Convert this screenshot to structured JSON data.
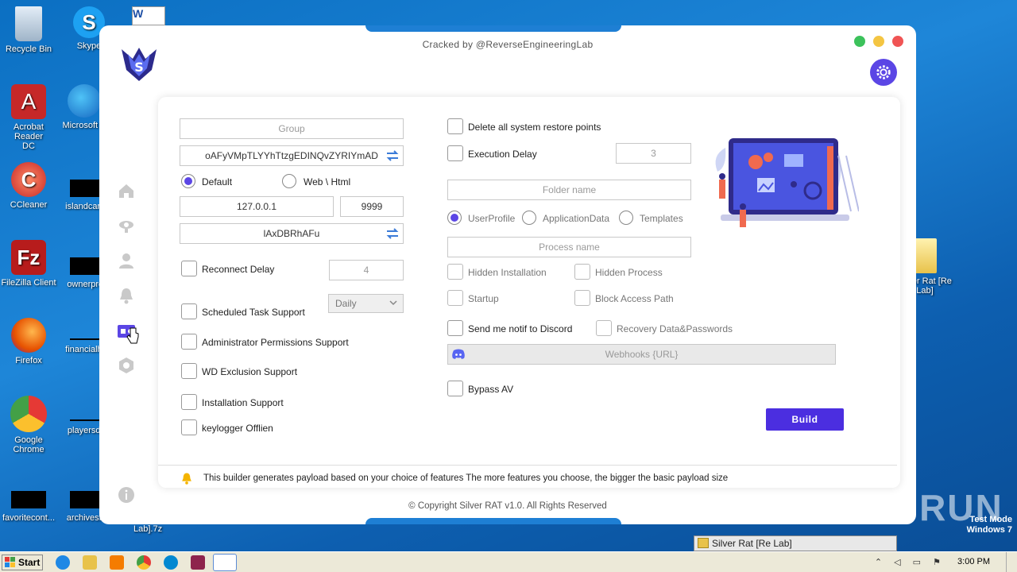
{
  "desktop": {
    "icons": [
      {
        "label": "Recycle Bin",
        "color": "#b7c7d8"
      },
      {
        "label": "Skype",
        "color": "#1da1f2"
      },
      {
        "label": "Acrobat Reader DC",
        "color": "#d32f2f"
      },
      {
        "label": "Microsoft E",
        "color": "#1e88e5"
      },
      {
        "label": "CCleaner",
        "color": "#e53935"
      },
      {
        "label": "islandcard.j",
        "color": "#000000"
      },
      {
        "label": "FileZilla Client",
        "color": "#c62828"
      },
      {
        "label": "ownerpres",
        "color": "#000000"
      },
      {
        "label": "Firefox",
        "color": "#ff7043"
      },
      {
        "label": "financialhot",
        "color": "#000000"
      },
      {
        "label": "Google Chrome",
        "color": "#43a047"
      },
      {
        "label": "playersdie",
        "color": "#000000"
      },
      {
        "label": "favoritecont...",
        "color": "#000000"
      },
      {
        "label": "archivesflo",
        "color": "#000000"
      },
      {
        "label": "Silver Rat [Re Lab]",
        "color": "#f5d76e"
      },
      {
        "label": "Lab].7z",
        "color": "#000000"
      }
    ]
  },
  "app": {
    "header": "Cracked by @ReverseEngineeringLab",
    "window_dots": {
      "green": "#3cc25b",
      "yellow": "#f4c542",
      "red": "#f05454"
    },
    "accent": "#5b46e5",
    "sidebar": [
      "home-icon",
      "eye-icon",
      "user-icon",
      "bell-icon",
      "builder-icon",
      "settings-hex-icon",
      "info-icon"
    ],
    "left": {
      "group_placeholder": "Group",
      "mutex": "oAFyVMpTLYYhTtzgEDINQvZYRIYmAD",
      "radio_default": "Default",
      "radio_web": "Web \\ Html",
      "host": "127.0.0.1",
      "port": "9999",
      "key": "lAxDBRhAFu",
      "reconnect_delay": "Reconnect Delay",
      "reconnect_value": "4",
      "scheduled_task": "Scheduled Task Support",
      "schedule_option": "Daily",
      "admin": "Administrator Permissions Support",
      "wd_exclusion": "WD Exclusion Support",
      "installation": "Installation Support",
      "keylogger": "keylogger Offlien"
    },
    "right": {
      "delete_restore": "Delete all system restore points",
      "execution_delay": "Execution Delay",
      "execution_value": "3",
      "folder_placeholder": "Folder name",
      "radio_userprofile": "UserProfile",
      "radio_appdata": "ApplicationData",
      "radio_templates": "Templates",
      "process_placeholder": "Process name",
      "hidden_installation": "Hidden Installation",
      "hidden_process": "Hidden Process",
      "startup": "Startup",
      "block_access": "Block Access Path",
      "discord_notif": "Send me notif to Discord",
      "recovery": "Recovery Data&Passwords",
      "webhook_placeholder": "Webhooks {URL}",
      "bypass_av": "Bypass AV",
      "build": "Build"
    },
    "info": "This builder generates payload based on your choice of features The more features you choose, the bigger the basic payload size",
    "copyright": "© Copyright Silver RAT v1.0. All Rights Reserved"
  },
  "taskbar": {
    "start": "Start",
    "task_item": "Silver Rat [Re Lab]",
    "clock": "3:00 PM",
    "watermark": "ANY RUN",
    "test_mode_1": "Test Mode",
    "test_mode_2": "Windows 7"
  }
}
